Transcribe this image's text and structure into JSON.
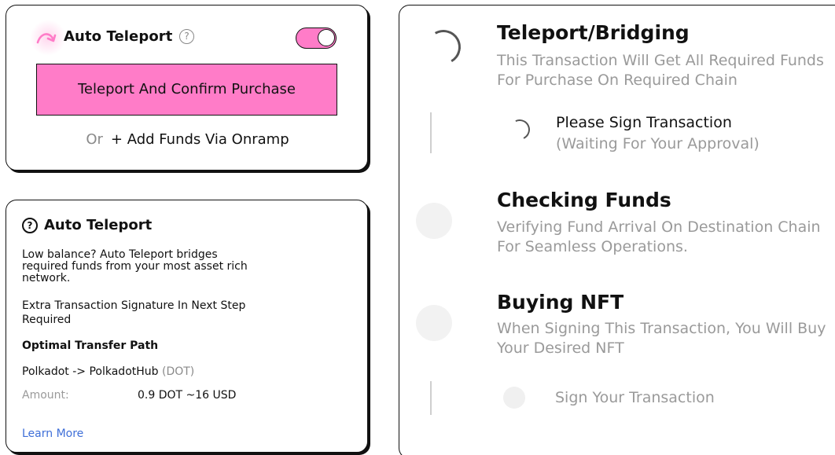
{
  "auto_teleport_card": {
    "icon": "teleport-arrow-icon",
    "title": "Auto Teleport",
    "help_icon": "?",
    "toggle_on": true,
    "primary_button": "Teleport And Confirm Purchase",
    "or_text": "Or",
    "onramp_link": "+ Add Funds Via Onramp",
    "accent_color": "#ff7cc8"
  },
  "tooltip": {
    "help_icon": "?",
    "title": "Auto Teleport",
    "description": "Low balance? Auto Teleport bridges required funds from your most asset rich network.",
    "extra_signature": "Extra Transaction Signature In Next Step Required",
    "path_heading": "Optimal Transfer Path",
    "path_text": "Polkadot  -> PolkadotHub",
    "path_token": "(DOT)",
    "amount_label": "Amount:",
    "amount_value": "0.9 DOT ~16 USD",
    "learn_more": "Learn More",
    "link_color": "#3f6fd8"
  },
  "steps": [
    {
      "title": "Teleport/Bridging",
      "description": "This Transaction Will Get All Required Funds For Purchase On Required Chain",
      "status": "in-progress",
      "substep": {
        "label": "Please Sign Transaction",
        "sublabel": "(Waiting For Your Approval)",
        "status": "in-progress"
      }
    },
    {
      "title": "Checking Funds",
      "description": "Verifying Fund Arrival On Destination Chain For Seamless Operations.",
      "status": "pending"
    },
    {
      "title": "Buying NFT",
      "description": "When Signing This Transaction, You Will Buy Your Desired NFT",
      "status": "pending",
      "substep": {
        "label": "Sign Your Transaction",
        "status": "pending"
      }
    }
  ]
}
